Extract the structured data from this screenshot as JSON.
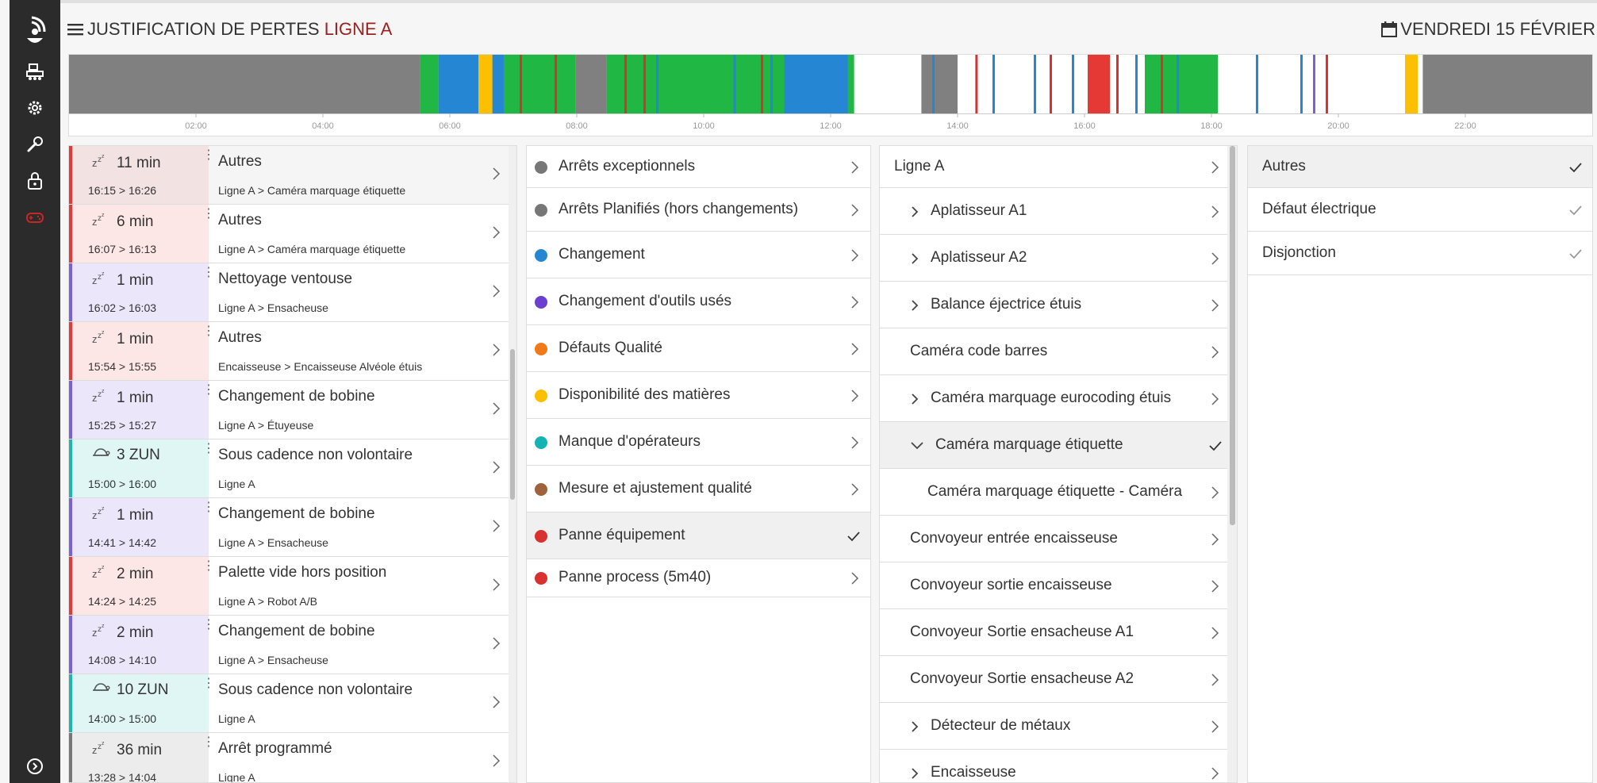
{
  "header": {
    "title_prefix": "JUSTIFICATION DE PERTES",
    "title_line": "LIGNE A",
    "date": "VENDREDI 15 FÉVRIER"
  },
  "sidebar": {
    "icons": [
      "logo-icon",
      "production-line-icon",
      "settings-gear-icon",
      "wrench-icon",
      "lock-icon",
      "gamepad-icon",
      "expand-sidebar-icon"
    ]
  },
  "timeline": {
    "hours": [
      "02:00",
      "04:00",
      "06:00",
      "08:00",
      "10:00",
      "12:00",
      "14:00",
      "16:00",
      "18:00",
      "20:00",
      "22:00"
    ],
    "segments_hours": [
      {
        "start": 0,
        "end": 5.53,
        "color": "#808080"
      },
      {
        "start": 5.53,
        "end": 5.82,
        "color": "#21b745"
      },
      {
        "start": 5.82,
        "end": 6.45,
        "color": "#2586d3"
      },
      {
        "start": 6.45,
        "end": 6.67,
        "color": "#fcc000"
      },
      {
        "start": 6.67,
        "end": 6.85,
        "color": "#2586d3"
      },
      {
        "start": 6.85,
        "end": 7.98,
        "color": "#21b745"
      },
      {
        "start": 7.98,
        "end": 8.47,
        "color": "#808080"
      },
      {
        "start": 8.47,
        "end": 12.37,
        "color": "#21b745"
      },
      {
        "start": 11.27,
        "end": 12.27,
        "color": "#2586d3"
      },
      {
        "start": 13.43,
        "end": 14.0,
        "color": "#808080"
      },
      {
        "start": 16.95,
        "end": 18.1,
        "color": "#21b745"
      },
      {
        "start": 21.33,
        "end": 24,
        "color": "#808080"
      }
    ]
  },
  "events": [
    {
      "icon": "sleep-icon",
      "duration": "11 min",
      "time": "16:15 > 16:26",
      "title": "Autres",
      "path": "Ligne A > Caméra marquage étiquette",
      "color": "#e53935",
      "bg": "#f2e2e2",
      "selected": true
    },
    {
      "icon": "sleep-icon",
      "duration": "6 min",
      "time": "16:07 > 16:13",
      "title": "Autres",
      "path": "Ligne A > Caméra marquage étiquette",
      "color": "#e53935",
      "bg": "#fde6e6"
    },
    {
      "icon": "sleep-icon",
      "duration": "1 min",
      "time": "16:02 > 16:03",
      "title": "Nettoyage ventouse",
      "path": "Ligne A > Ensacheuse",
      "color": "#7b61d9",
      "bg": "#ece6fb"
    },
    {
      "icon": "sleep-icon",
      "duration": "1 min",
      "time": "15:54 > 15:55",
      "title": "Autres",
      "path": "Encaisseuse > Encaisseuse Alvéole étuis",
      "color": "#e53935",
      "bg": "#fde6e6"
    },
    {
      "icon": "sleep-icon",
      "duration": "1 min",
      "time": "15:25 > 15:27",
      "title": "Changement de bobine",
      "path": "Ligne A > Étuyeuse",
      "color": "#7b61d9",
      "bg": "#ece6fb"
    },
    {
      "icon": "turtle-icon",
      "duration": "3 ZUN",
      "time": "15:00 > 16:00",
      "title": "Sous cadence non volontaire",
      "path": "Ligne A",
      "color": "#1fb5ad",
      "bg": "#e0f6f4"
    },
    {
      "icon": "sleep-icon",
      "duration": "1 min",
      "time": "14:41 > 14:42",
      "title": "Changement de bobine",
      "path": "Ligne A > Ensacheuse",
      "color": "#7b61d9",
      "bg": "#ece6fb"
    },
    {
      "icon": "sleep-icon",
      "duration": "2 min",
      "time": "14:24 > 14:25",
      "title": "Palette vide hors position",
      "path": "Ligne A > Robot A/B",
      "color": "#e53935",
      "bg": "#fde6e6"
    },
    {
      "icon": "sleep-icon",
      "duration": "2 min",
      "time": "14:08 > 14:10",
      "title": "Changement de bobine",
      "path": "Ligne A > Ensacheuse",
      "color": "#7b61d9",
      "bg": "#ece6fb"
    },
    {
      "icon": "turtle-icon",
      "duration": "10 ZUN",
      "time": "14:00 > 15:00",
      "title": "Sous cadence non volontaire",
      "path": "Ligne A",
      "color": "#1fb5ad",
      "bg": "#e0f6f4"
    },
    {
      "icon": "sleep-icon",
      "duration": "36 min",
      "time": "13:28 > 14:04",
      "title": "Arrêt programmé",
      "path": "Ligne A",
      "color": "#777777",
      "bg": "#ececec"
    }
  ],
  "categories": [
    {
      "label": "Arrêts exceptionnels",
      "color": "#777777"
    },
    {
      "label": "Arrêts Planifiés (hors changements)",
      "color": "#777777"
    },
    {
      "label": "Changement",
      "color": "#2586d3"
    },
    {
      "label": "Changement d'outils usés",
      "color": "#6a3fd1"
    },
    {
      "label": "Défauts Qualité",
      "color": "#f07a1a"
    },
    {
      "label": "Disponibilité des matières",
      "color": "#fcc000"
    },
    {
      "label": "Manque d'opérateurs",
      "color": "#15b3b3"
    },
    {
      "label": "Mesure et ajustement qualité",
      "color": "#a0623a"
    },
    {
      "label": "Panne équipement",
      "color": "#d93030",
      "selected": true
    },
    {
      "label": "Panne process (5m40)",
      "color": "#d93030"
    }
  ],
  "equipment": [
    {
      "label": "Ligne A",
      "level": 0
    },
    {
      "label": "Aplatisseur A1",
      "level": 1,
      "expander": "collapsed"
    },
    {
      "label": "Aplatisseur A2",
      "level": 1,
      "expander": "collapsed"
    },
    {
      "label": "Balance éjectrice étuis",
      "level": 1,
      "expander": "collapsed"
    },
    {
      "label": "Caméra code barres",
      "level": 1
    },
    {
      "label": "Caméra marquage eurocoding étuis",
      "level": 1,
      "expander": "collapsed"
    },
    {
      "label": "Caméra marquage étiquette",
      "level": 1,
      "expander": "expanded",
      "selected": true
    },
    {
      "label": "Caméra marquage étiquette - Caméra",
      "level": 2
    },
    {
      "label": "Convoyeur entrée encaisseuse",
      "level": 1
    },
    {
      "label": "Convoyeur sortie encaisseuse",
      "level": 1
    },
    {
      "label": "Convoyeur Sortie ensacheuse A1",
      "level": 1
    },
    {
      "label": "Convoyeur Sortie ensacheuse A2",
      "level": 1
    },
    {
      "label": "Détecteur de métaux",
      "level": 1,
      "expander": "collapsed"
    },
    {
      "label": "Encaisseuse",
      "level": 1,
      "expander": "collapsed"
    }
  ],
  "causes": [
    {
      "label": "Autres",
      "selected": true
    },
    {
      "label": "Défaut électrique"
    },
    {
      "label": "Disjonction"
    }
  ]
}
